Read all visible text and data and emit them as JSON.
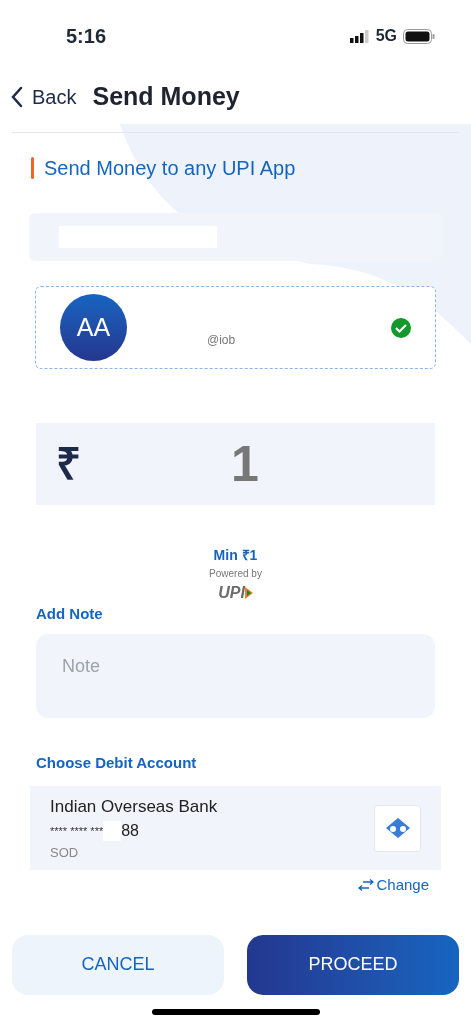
{
  "status_bar": {
    "time": "5:16",
    "network": "5G"
  },
  "header": {
    "back_label": "Back",
    "title": "Send Money"
  },
  "section_title": "Send Money to any UPI App",
  "payee": {
    "initials": "AA",
    "handle": "@iob",
    "verified": true
  },
  "amount": {
    "currency": "₹",
    "value": "1"
  },
  "min_label": "Min ₹1",
  "powered_by": "Powered by",
  "upi_logo": "UPI",
  "note": {
    "label": "Add Note",
    "placeholder": "Note"
  },
  "debit": {
    "label": "Choose Debit Account",
    "bank": "Indian Overseas Bank",
    "masked": "**** **** ***",
    "suffix": "88",
    "type": "SOD",
    "change": "Change"
  },
  "buttons": {
    "cancel": "CANCEL",
    "proceed": "PROCEED"
  }
}
